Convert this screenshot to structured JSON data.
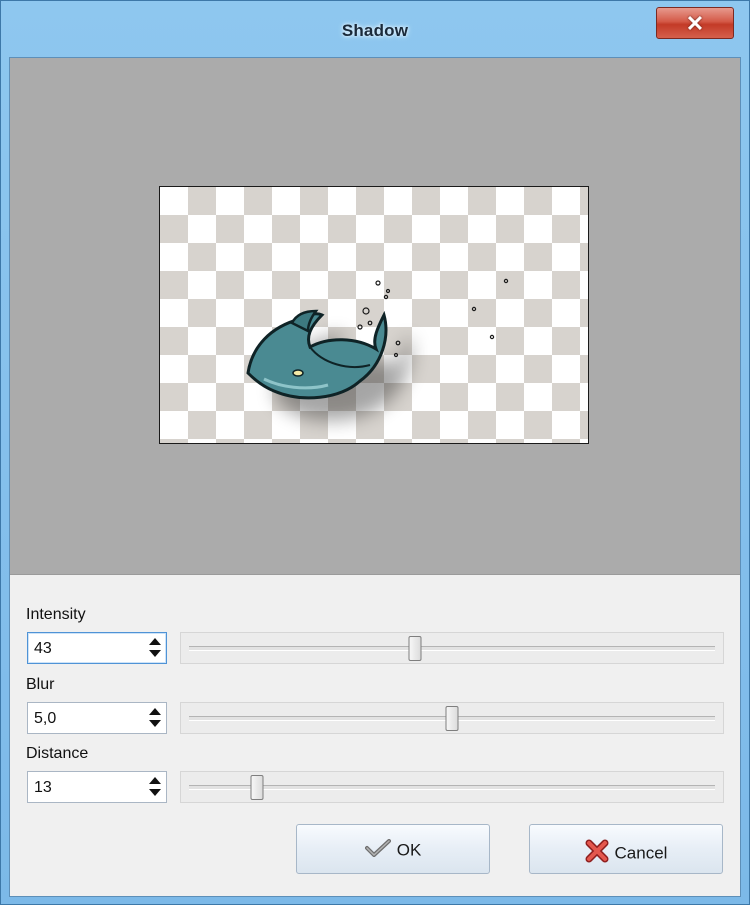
{
  "window": {
    "title": "Shadow",
    "close_icon": "close-icon"
  },
  "preview": {
    "background": "#ababab",
    "checker_color": "#d7d3ce"
  },
  "fields": [
    {
      "label": "Intensity",
      "value": "43",
      "slider_fraction": 0.43
    },
    {
      "label": "Blur",
      "value": "5,0",
      "slider_fraction": 0.5
    },
    {
      "label": "Distance",
      "value": "13",
      "slider_fraction": 0.13
    }
  ],
  "buttons": {
    "ok_label": "OK",
    "ok_icon": "checkmark-icon",
    "cancel_label": "Cancel",
    "cancel_icon": "cross-icon"
  },
  "colors": {
    "titlebar": "#8ec7ef",
    "close": "#c33a27",
    "dolphin": "#4a8a92"
  }
}
